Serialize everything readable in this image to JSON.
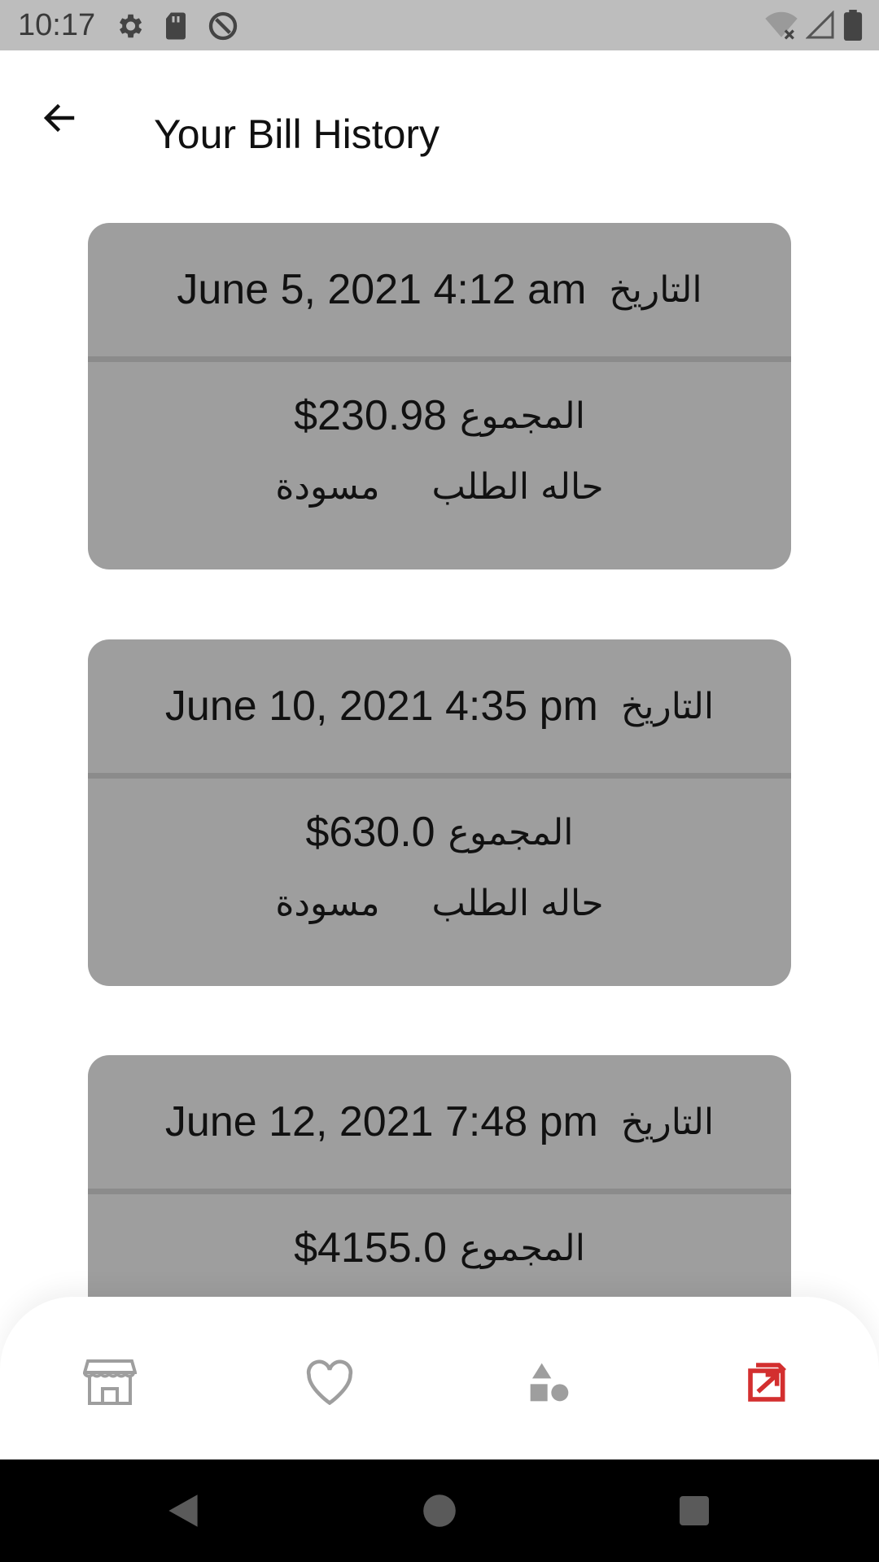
{
  "status_bar": {
    "time": "10:17",
    "icons": [
      "gear-icon",
      "sd-card-icon",
      "no-sync-icon",
      "wifi-off-icon",
      "signal-icon",
      "battery-icon"
    ]
  },
  "header": {
    "title": "Your Bill History",
    "back_icon": "arrow-left-icon"
  },
  "bills": [
    {
      "date": "June 5, 2021 4:12 am",
      "date_label": "التاريخ",
      "total": "$230.98",
      "total_label": "المجموع",
      "status_label": "حاله الطلب",
      "status_value": "مسودة"
    },
    {
      "date": "June 10, 2021 4:35 pm",
      "date_label": "التاريخ",
      "total": "$630.0",
      "total_label": "المجموع",
      "status_label": "حاله الطلب",
      "status_value": "مسودة"
    },
    {
      "date": "June 12, 2021 7:48 pm",
      "date_label": "التاريخ",
      "total": "$4155.0",
      "total_label": "المجموع"
    }
  ],
  "bottom_nav": {
    "items": [
      {
        "icon": "store-icon",
        "active": false
      },
      {
        "icon": "heart-icon",
        "active": false
      },
      {
        "icon": "shapes-icon",
        "active": false
      },
      {
        "icon": "bill-history-icon",
        "active": true
      }
    ],
    "colors": {
      "inactive": "#9e9e9e",
      "active": "#d32f2f"
    }
  },
  "system_nav": {
    "buttons": [
      "back-triangle-icon",
      "home-circle-icon",
      "recents-square-icon"
    ]
  }
}
